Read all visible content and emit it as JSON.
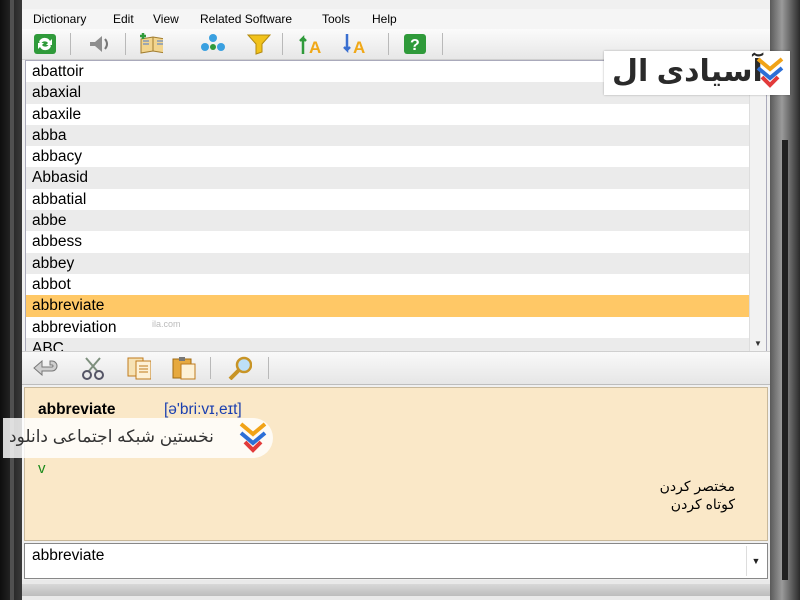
{
  "menu": [
    "Dictionary",
    "Edit",
    "View",
    "Related Software",
    "Tools",
    "Help"
  ],
  "toolbar_icons": [
    "refresh-icon",
    "speaker-icon",
    "add-entry-icon",
    "network-icon",
    "filter-icon",
    "sort-ascending-icon",
    "sort-descending-icon",
    "help-icon"
  ],
  "words": [
    "abattoir",
    "abaxial",
    "abaxile",
    "abba",
    "abbacy",
    "Abbasid",
    "abbatial",
    "abbe",
    "abbess",
    "abbey",
    "abbot",
    "abbreviate",
    "abbreviation",
    "ABC"
  ],
  "selected_index": 11,
  "toolbar2_icons": [
    "undo-icon",
    "cut-icon",
    "copy-icon",
    "paste-icon",
    "search-icon"
  ],
  "definition": {
    "headword": "abbreviate",
    "phonetic": "[ə'bri:vɪ,eɪt]",
    "pos": "v",
    "meanings": [
      "مختصر کردن",
      "کوتاه کردن"
    ]
  },
  "input": {
    "value": "abbreviate"
  },
  "watermark": {
    "logo": "آسیادی ال",
    "banner": "نخستین شبکه اجتماعی دانلود",
    "small": "ila.com"
  },
  "colors": {
    "selection": "#ffc866",
    "definition_bg": "#fae8c8",
    "phonetic": "#1a3fb0",
    "pos": "#1a8a1a"
  }
}
